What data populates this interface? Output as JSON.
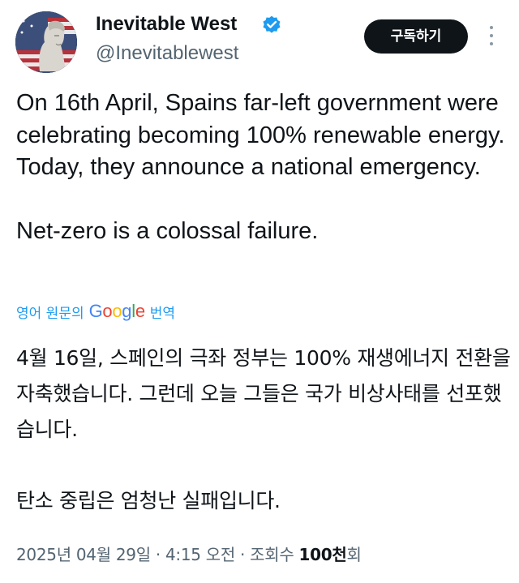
{
  "author": {
    "display_name": "Inevitable West",
    "handle": "@Inevitablewest",
    "verified_icon": "verified-badge-icon",
    "avatar_icon": "statue-flag-avatar"
  },
  "actions": {
    "subscribe_label": "구독하기",
    "more_icon": "more-vertical-icon"
  },
  "tweet": {
    "paragraph_1": "On 16th April, Spains far-left government were celebrating becoming 100% renewable energy. Today, they announce a national emergency.",
    "paragraph_2": "Net-zero is a colossal failure."
  },
  "translation": {
    "prefix": "영어 원문의",
    "suffix": "번역",
    "paragraph_1": "4월 16일, 스페인의 극좌 정부는 100% 재생에너지 전환을 자축했습니다. 그런데 오늘 그들은 국가 비상사태를 선포했습니다.",
    "paragraph_2": "탄소 중립은 엄청난 실패입니다."
  },
  "google_logo": {
    "letters": [
      "G",
      "o",
      "o",
      "g",
      "l",
      "e"
    ],
    "colors": [
      "#4285F4",
      "#EA4335",
      "#FBBC05",
      "#4285F4",
      "#34A853",
      "#EA4335"
    ]
  },
  "meta": {
    "date": "2025년 04월 29일",
    "separator": "·",
    "time": "4:15 오전",
    "views_label": "조회수",
    "views_count": "100천",
    "views_suffix": "회"
  },
  "colors": {
    "text_primary": "#0f1419",
    "text_secondary": "#536471",
    "accent_blue": "#1d9bf0",
    "button_bg": "#0f1419"
  }
}
